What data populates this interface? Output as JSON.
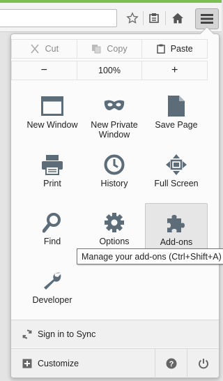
{
  "edit": {
    "cut_label": "Cut",
    "copy_label": "Copy",
    "paste_label": "Paste"
  },
  "zoom": {
    "decrease_label": "−",
    "level": "100%",
    "increase_label": "+"
  },
  "items": [
    {
      "label": "New Window",
      "icon": "window-icon"
    },
    {
      "label": "New Private Window",
      "icon": "mask-icon"
    },
    {
      "label": "Save Page",
      "icon": "page-icon"
    },
    {
      "label": "Print",
      "icon": "printer-icon"
    },
    {
      "label": "History",
      "icon": "clock-icon"
    },
    {
      "label": "Full Screen",
      "icon": "fullscreen-icon"
    },
    {
      "label": "Find",
      "icon": "magnifier-icon"
    },
    {
      "label": "Options",
      "icon": "gear-icon"
    },
    {
      "label": "Add-ons",
      "icon": "puzzle-icon"
    },
    {
      "label": "Developer",
      "icon": "wrench-icon"
    }
  ],
  "tooltip": "Manage your add-ons (Ctrl+Shift+A)",
  "sync_label": "Sign in to Sync",
  "customize_label": "Customize",
  "colors": {
    "icon": "#5c6c79",
    "accent_strip": "#7bbf52"
  }
}
